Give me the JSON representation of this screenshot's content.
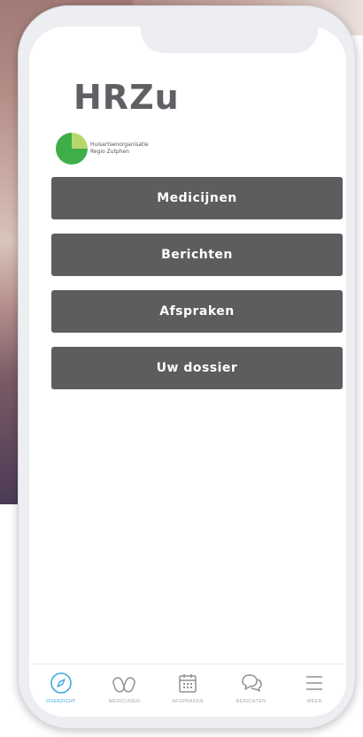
{
  "brand": {
    "name": "HRZu",
    "subtitle_line1": "Huisartsenorganisatie",
    "subtitle_line2": "Regio Zutphen"
  },
  "menu": {
    "items": [
      {
        "label": "Medicijnen"
      },
      {
        "label": "Berichten"
      },
      {
        "label": "Afspraken"
      },
      {
        "label": "Uw dossier"
      }
    ]
  },
  "tabbar": {
    "items": [
      {
        "label": "OVERZICHT",
        "icon": "compass-icon",
        "active": true
      },
      {
        "label": "MEDICIJNEN",
        "icon": "pills-icon",
        "active": false
      },
      {
        "label": "AFSPRAKEN",
        "icon": "calendar-icon",
        "active": false
      },
      {
        "label": "BERICHTEN",
        "icon": "chat-icon",
        "active": false
      },
      {
        "label": "MEER",
        "icon": "hamburger-icon",
        "active": false
      }
    ]
  },
  "colors": {
    "button_bg": "#5c5d5f",
    "active_tab": "#3fa9e0",
    "logo_green": "#3fae49"
  }
}
